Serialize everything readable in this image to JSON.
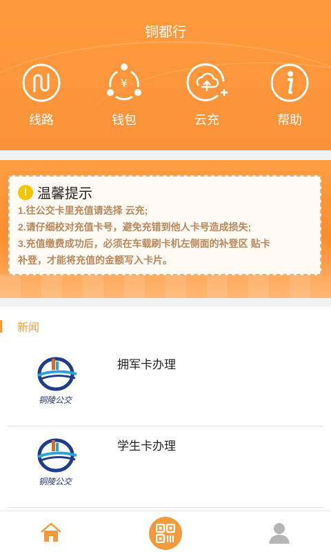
{
  "header": {
    "title": "铜都行",
    "menu": [
      {
        "label": "线路",
        "icon": "route-icon"
      },
      {
        "label": "钱包",
        "icon": "wallet-icon"
      },
      {
        "label": "云充",
        "icon": "cloud-recharge-icon"
      },
      {
        "label": "帮助",
        "icon": "help-icon"
      }
    ]
  },
  "notice": {
    "title": "温馨提示",
    "lines": [
      "1.往公交卡里充值请选择 云充;",
      "2.请仔细校对充值卡号，避免充错到他人卡号造成损失;",
      "3.充值缴费成功后，必须在车载刷卡机左侧面的补登区 贴卡",
      "补登，才能将充值的金额写入卡片。"
    ]
  },
  "news": {
    "heading": "新闻",
    "items": [
      {
        "title": "拥军卡办理",
        "logo_text": "铜陵公交"
      },
      {
        "title": "学生卡办理",
        "logo_text": "铜陵公交"
      }
    ]
  },
  "tabbar": {
    "items": [
      "home-icon",
      "qr-scan-icon",
      "user-icon"
    ]
  },
  "colors": {
    "accent": "#f39a3f",
    "header_bg": "#ff9a3c",
    "notice_text": "#b8865a"
  }
}
